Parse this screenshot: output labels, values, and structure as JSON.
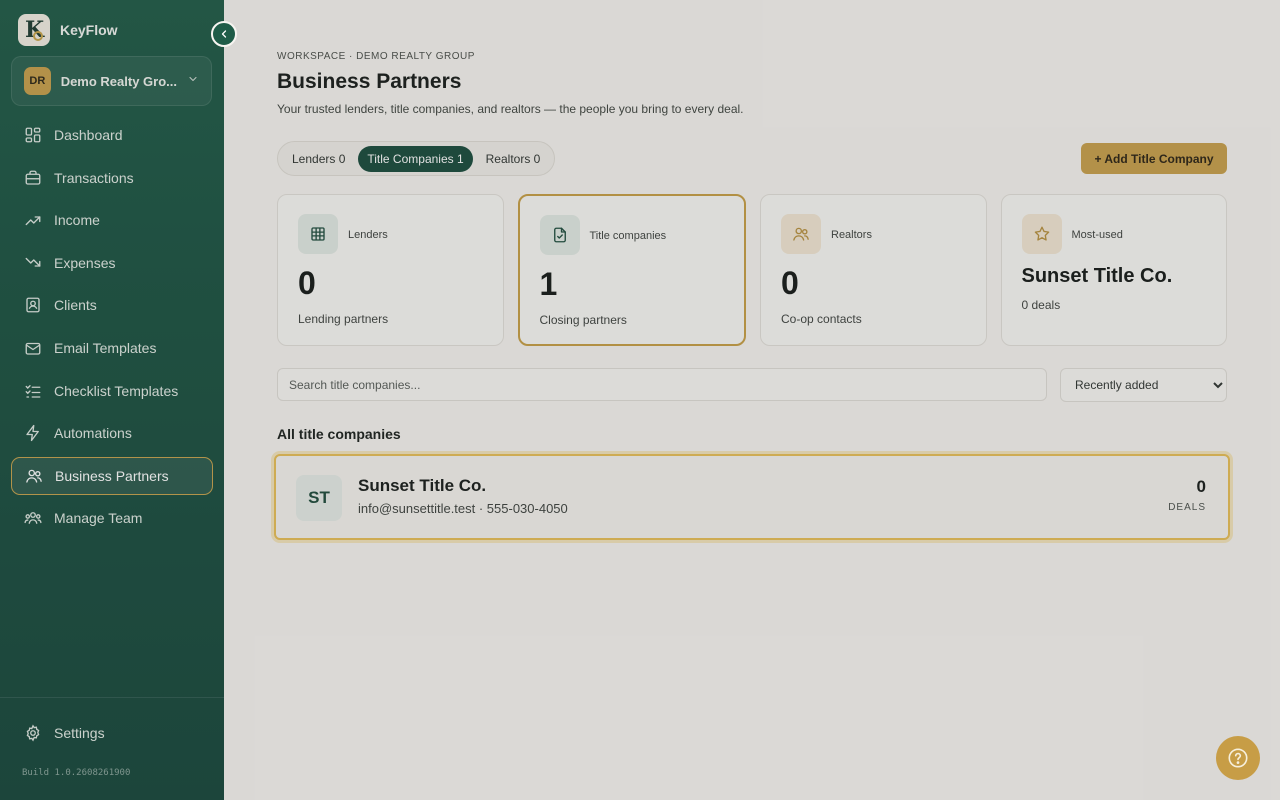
{
  "brand": {
    "name": "KeyFlow",
    "logo_letter": "K"
  },
  "workspace": {
    "initials": "DR",
    "name": "Demo Realty Gro..."
  },
  "nav": {
    "items": [
      {
        "label": "Dashboard",
        "icon": "dashboard-icon"
      },
      {
        "label": "Transactions",
        "icon": "briefcase-icon"
      },
      {
        "label": "Income",
        "icon": "trending-up-icon"
      },
      {
        "label": "Expenses",
        "icon": "trending-down-icon"
      },
      {
        "label": "Clients",
        "icon": "contacts-icon"
      },
      {
        "label": "Email Templates",
        "icon": "mail-icon"
      },
      {
        "label": "Checklist Templates",
        "icon": "checklist-icon"
      },
      {
        "label": "Automations",
        "icon": "bolt-icon"
      },
      {
        "label": "Business Partners",
        "icon": "users-icon",
        "active": true
      },
      {
        "label": "Manage Team",
        "icon": "team-icon"
      }
    ],
    "settings_label": "Settings",
    "build": "Build 1.0.2608261900"
  },
  "header": {
    "breadcrumb": "WORKSPACE · DEMO REALTY GROUP",
    "title": "Business Partners",
    "subtitle": "Your trusted lenders, title companies, and realtors — the people you bring to every deal."
  },
  "tabs": [
    {
      "label": "Lenders 0"
    },
    {
      "label": "Title Companies 1",
      "active": true
    },
    {
      "label": "Realtors 0"
    }
  ],
  "add_button": "+ Add Title Company",
  "cards": {
    "lenders": {
      "label": "Lenders",
      "value": "0",
      "desc": "Lending partners"
    },
    "title": {
      "label": "Title companies",
      "value": "1",
      "desc": "Closing partners"
    },
    "realtors": {
      "label": "Realtors",
      "value": "0",
      "desc": "Co-op contacts"
    },
    "most_used": {
      "label": "Most-used",
      "value": "Sunset Title Co.",
      "desc": "0 deals"
    }
  },
  "search": {
    "placeholder": "Search title companies..."
  },
  "sort": {
    "selected": "Recently added"
  },
  "list": {
    "heading": "All title companies",
    "rows": [
      {
        "initials": "ST",
        "name": "Sunset Title Co.",
        "meta": "info@sunsettitle.test · 555-030-4050",
        "count": "0",
        "count_label": "DEALS"
      }
    ]
  },
  "colors": {
    "sidebar": "#1d5a46",
    "accent": "#c9a04a",
    "active_tab": "#174a3b",
    "highlight": "#e9bf55"
  }
}
